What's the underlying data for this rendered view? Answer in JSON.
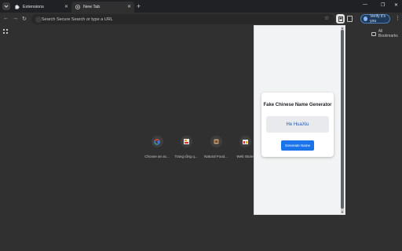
{
  "browser": {
    "tabs": [
      {
        "title": "Extensions",
        "active": false
      },
      {
        "title": "New Tab",
        "active": true
      }
    ],
    "omnibox": {
      "placeholder": "Search Secure Search or type a URL"
    },
    "profile_button": {
      "label": "Verify it's you"
    },
    "bookmarks": {
      "all_bookmarks_label": "All Bookmarks"
    }
  },
  "new_tab": {
    "shortcuts": [
      {
        "label": "Choose an ac...",
        "icon": "google-icon"
      },
      {
        "label": "Trang tổng q...",
        "icon": "site-icon"
      },
      {
        "label": "Natural Food...",
        "icon": "food-icon"
      },
      {
        "label": "Web Store",
        "icon": "web-store-icon"
      }
    ]
  },
  "extension_popup": {
    "title": "Fake Chinese Name Generator",
    "generated_name": "He HuaXiu",
    "button_label": "Generate Name"
  },
  "colors": {
    "accent": "#1a73e8",
    "name_text": "#1a5fb4",
    "background": "#303030"
  }
}
